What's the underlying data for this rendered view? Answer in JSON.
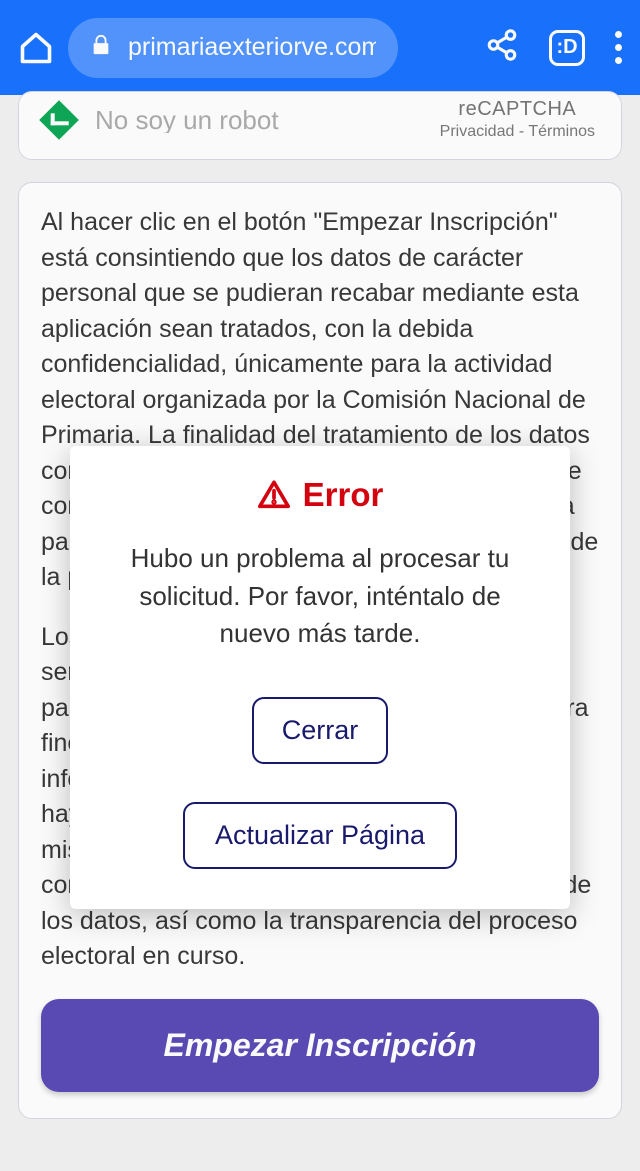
{
  "chrome": {
    "url": "primariaexteriorve.com",
    "tab_indicator": ":D"
  },
  "recaptcha": {
    "label": "No soy un robot",
    "brand": "reCAPTCHA",
    "privacy": "Privacidad",
    "terms": "Términos"
  },
  "consent": {
    "p1": "Al hacer clic en el botón \"Empezar Inscripción\" está consintiendo que los datos de carácter personal que se pudieran recabar mediante esta aplicación sean tratados, con la debida confidencialidad, únicamente para la actividad electoral organizada por la Comisión Nacional de Primaria. La finalidad del tratamiento de los datos corresponde a la actualización de la dirección de correo electrónico y otros datos necesarios para participar, quedando estos datos dentro y fuera de la primaria.",
    "p2": "Los datos suministrados en este formulario solo serán conservados durante el tiempo necesario para los fines descritos y no serán utilizados para fines distintos a la actividad electoral. La información puede ser compartida con quienes hayan sido debidamente autorizados, con los mismos fines, y siempre respetando la confidencialidad y los derechos de los titulares de los datos, así como la transparencia del proceso electoral en curso."
  },
  "cta_label": "Empezar Inscripción",
  "modal": {
    "title": "Error",
    "message": "Hubo un problema al procesar tu solicitud. Por favor, inténtalo de nuevo más tarde.",
    "close_label": "Cerrar",
    "refresh_label": "Actualizar Página"
  }
}
